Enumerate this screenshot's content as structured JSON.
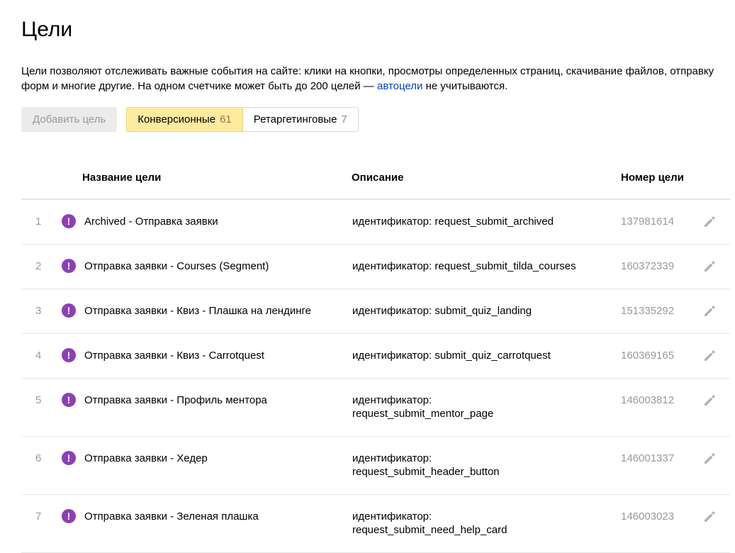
{
  "page": {
    "title": "Цели",
    "description_text": "Цели позволяют отслеживать важные события на сайте: клики на кнопки, просмотры определенных страниц, скачивание файлов, отправку форм и многие другие. На одном счетчике может быть до 200 целей — ",
    "description_link": "автоцели",
    "description_tail": " не учитываются."
  },
  "toolbar": {
    "add_label": "Добавить цель",
    "tabs": [
      {
        "label": "Конверсионные",
        "count": "61",
        "active": true
      },
      {
        "label": "Ретаргетинговые",
        "count": "7",
        "active": false
      }
    ]
  },
  "table": {
    "headers": {
      "name": "Название цели",
      "description": "Описание",
      "id": "Номер цели"
    },
    "rows": [
      {
        "num": "1",
        "name": "Archived - Отправка заявки",
        "desc_label": "идентификатор:",
        "desc_value": "request_submit_archived",
        "goal_id": "137981614"
      },
      {
        "num": "2",
        "name": "Отправка заявки - Courses (Segment)",
        "desc_label": "идентификатор:",
        "desc_value": "request_submit_tilda_courses",
        "goal_id": "160372339"
      },
      {
        "num": "3",
        "name": "Отправка заявки - Квиз - Плашка на лендинге",
        "desc_label": "идентификатор:",
        "desc_value": "submit_quiz_landing",
        "goal_id": "151335292"
      },
      {
        "num": "4",
        "name": "Отправка заявки - Квиз - Carrotquest",
        "desc_label": "идентификатор:",
        "desc_value": "submit_quiz_carrotquest",
        "goal_id": "160369165"
      },
      {
        "num": "5",
        "name": "Отправка заявки - Профиль ментора",
        "desc_label": "идентификатор:",
        "desc_value": "request_submit_mentor_page",
        "goal_id": "146003812"
      },
      {
        "num": "6",
        "name": "Отправка заявки - Хедер",
        "desc_label": "идентификатор:",
        "desc_value": "request_submit_header_button",
        "goal_id": "146001337"
      },
      {
        "num": "7",
        "name": "Отправка заявки - Зеленая плашка",
        "desc_label": "идентификатор:",
        "desc_value": "request_submit_need_help_card",
        "goal_id": "146003023"
      }
    ]
  },
  "icons": {
    "warning": "warning-icon",
    "edit": "pencil-icon",
    "warning_glyph": "!"
  },
  "colors": {
    "active_tab_bg": "#ffeba0",
    "warning_icon": "#8e3fb6",
    "link": "#0044bb"
  }
}
